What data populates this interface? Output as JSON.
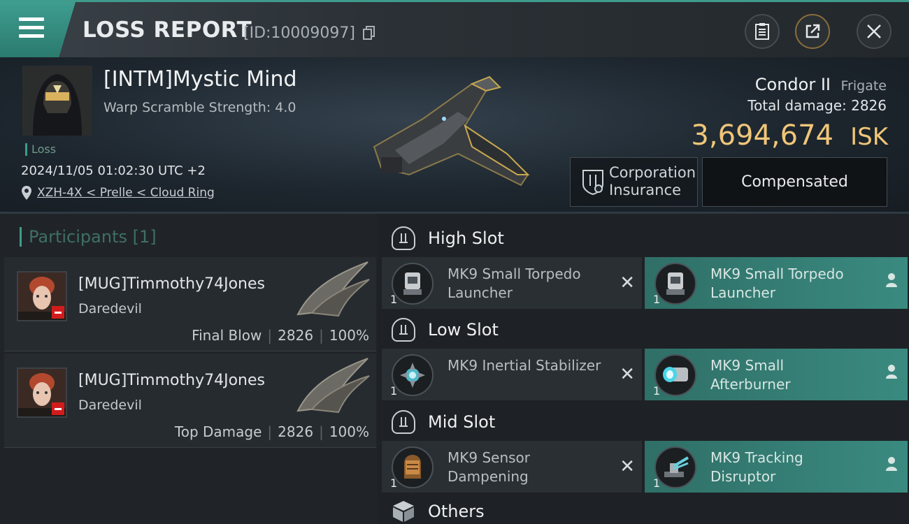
{
  "header": {
    "title": "LOSS REPORT",
    "report_id": "[ID:10009097]",
    "icons": [
      "menu-icon",
      "copy-icon",
      "clipboard-icon",
      "share-icon",
      "close-icon"
    ]
  },
  "victim": {
    "name": "[INTM]Mystic Mind",
    "warp_scramble": "Warp Scramble Strength: 4.0",
    "result_tag": "Loss",
    "datetime": "2024/11/05 01:02:30 UTC +2",
    "location": "XZH-4X < Prelle < Cloud Ring"
  },
  "ship": {
    "name": "Condor II",
    "class": "Frigate",
    "total_damage": "Total damage:  2826",
    "isk_value": "3,694,674",
    "isk_unit": "ISK",
    "insurance_label": "Corporation Insurance",
    "insurance_status": "Compensated"
  },
  "participants": {
    "heading": "Participants [1]",
    "items": [
      {
        "name": "[MUG]Timmothy74Jones",
        "ship": "Daredevil",
        "role": "Final Blow",
        "damage": "2826",
        "percent": "100%"
      },
      {
        "name": "[MUG]Timmothy74Jones",
        "ship": "Daredevil",
        "role": "Top Damage",
        "damage": "2826",
        "percent": "100%"
      }
    ]
  },
  "fitting": {
    "high_slot": {
      "label": "High Slot",
      "destroyed": {
        "name": "MK9 Small Torpedo Launcher",
        "qty": "1"
      },
      "dropped": {
        "name": "MK9 Small Torpedo Launcher",
        "qty": "1"
      }
    },
    "low_slot": {
      "label": "Low Slot",
      "destroyed": {
        "name": "MK9 Inertial Stabilizer",
        "qty": "1"
      },
      "dropped": {
        "name": "MK9 Small Afterburner",
        "qty": "1"
      }
    },
    "mid_slot": {
      "label": "Mid Slot",
      "destroyed": {
        "name": "MK9 Sensor Dampening",
        "qty": "1"
      },
      "dropped": {
        "name": "MK9 Tracking Disruptor",
        "qty": "1"
      }
    },
    "others": {
      "label": "Others"
    }
  },
  "colors": {
    "accent_teal": "#3f9b8c",
    "isk_gold": "#f0c679",
    "dropped_teal": "#3a8a80"
  }
}
